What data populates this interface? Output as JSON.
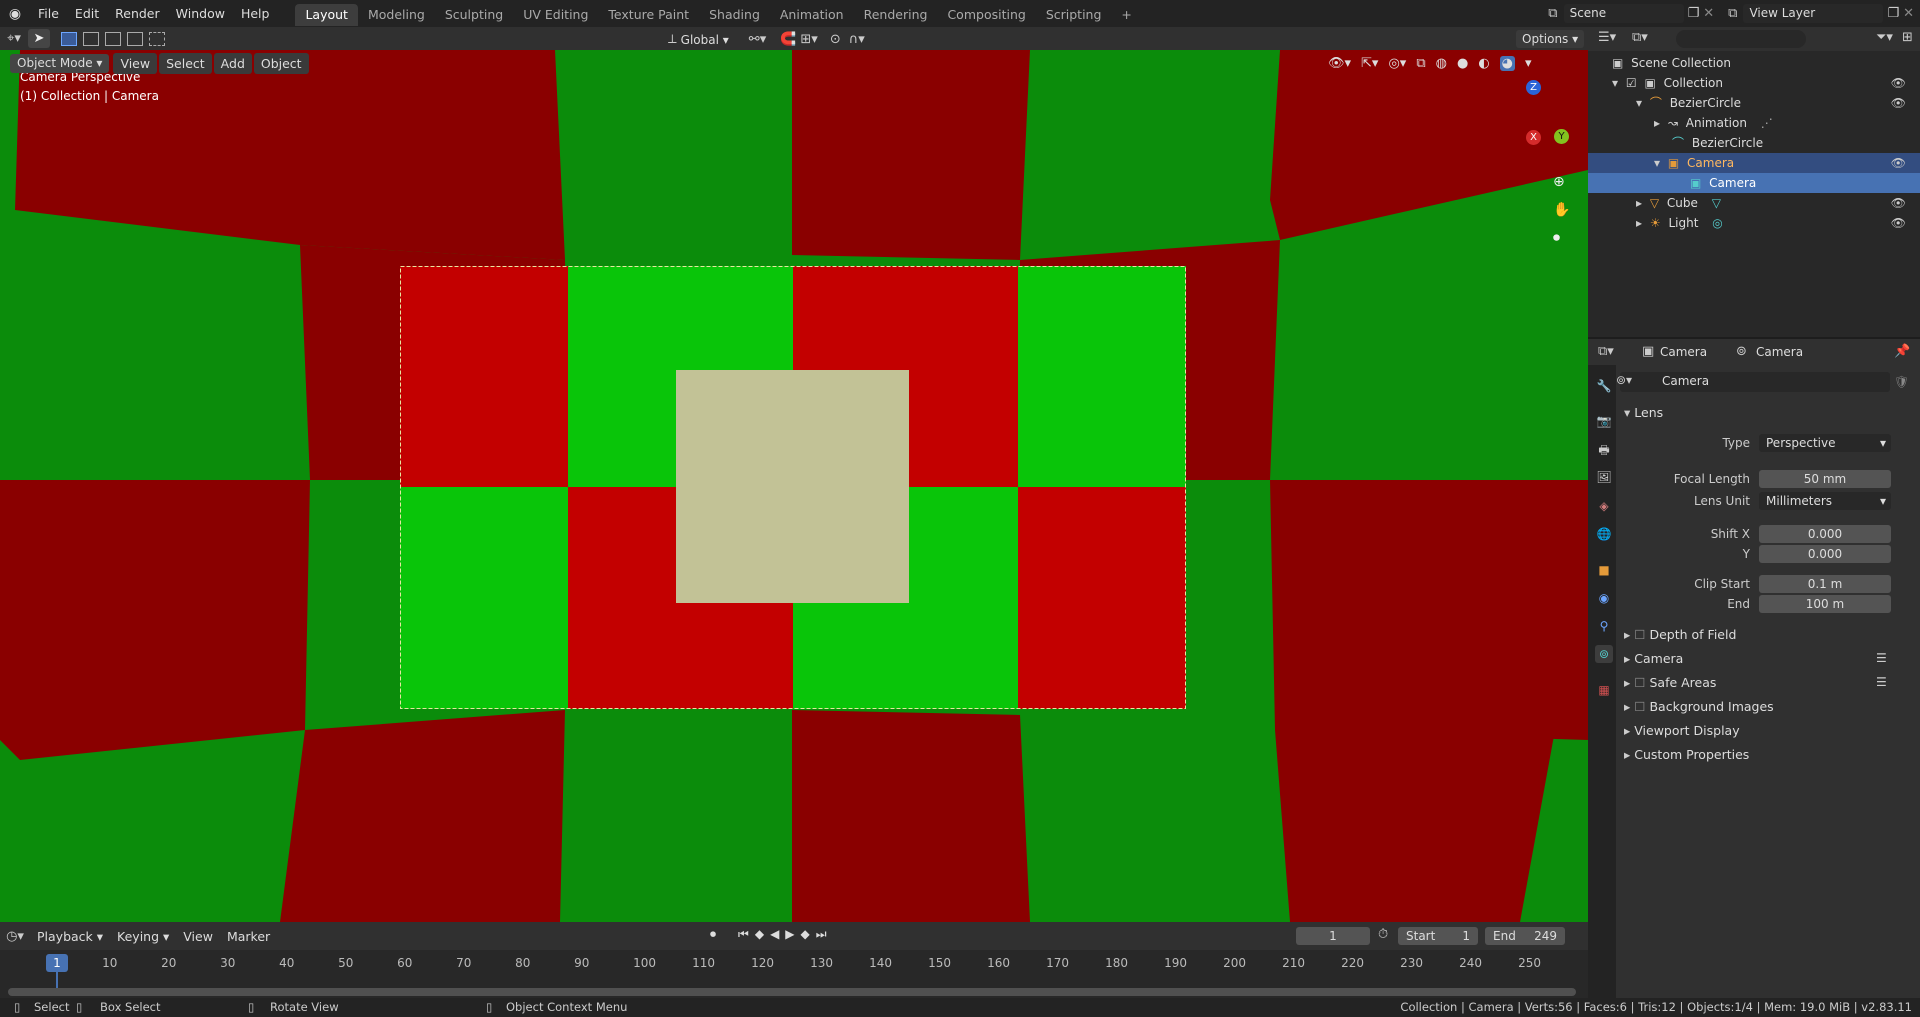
{
  "topbar": {
    "menus": [
      "File",
      "Edit",
      "Render",
      "Window",
      "Help"
    ],
    "workspaces": [
      "Layout",
      "Modeling",
      "Sculpting",
      "UV Editing",
      "Texture Paint",
      "Shading",
      "Animation",
      "Rendering",
      "Compositing",
      "Scripting"
    ],
    "active_workspace": "Layout",
    "add_tab": "+",
    "scene": "Scene",
    "view_layer": "View Layer"
  },
  "viewport_header": {
    "mode": "Object Mode",
    "menus": [
      "View",
      "Select",
      "Add",
      "Object"
    ],
    "orientation": "Global",
    "options": "Options"
  },
  "viewport": {
    "overlay_title": "Camera Perspective",
    "overlay_subtitle": "(1) Collection | Camera",
    "gizmo_axes": {
      "z": "Z",
      "x": "X",
      "y": "Y"
    },
    "colors": {
      "red": "#c30000",
      "green": "#09c509",
      "dark_red": "#8a0000",
      "dark_green": "#0b8c0b",
      "cube": "#c2c296"
    }
  },
  "outliner": {
    "rows": [
      {
        "label": "Scene Collection",
        "icon": "scene-collection-icon"
      },
      {
        "label": "Collection",
        "icon": "collection-icon"
      },
      {
        "label": "BezierCircle",
        "icon": "curve-icon"
      },
      {
        "label": "Animation",
        "icon": "animation-icon"
      },
      {
        "label": "BezierCircle",
        "icon": "curve-data-icon"
      },
      {
        "label": "Camera",
        "icon": "camera-icon"
      },
      {
        "label": "Camera",
        "icon": "camera-data-icon"
      },
      {
        "label": "Cube",
        "icon": "mesh-icon"
      },
      {
        "label": "Light",
        "icon": "light-icon"
      }
    ]
  },
  "properties": {
    "breadcrumb_object": "Camera",
    "breadcrumb_data": "Camera",
    "datablock": "Camera",
    "lens_panel": "Lens",
    "type_label": "Type",
    "type_value": "Perspective",
    "focal_length_label": "Focal Length",
    "focal_length_value": "50 mm",
    "lens_unit_label": "Lens Unit",
    "lens_unit_value": "Millimeters",
    "shift_x_label": "Shift X",
    "shift_x_value": "0.000",
    "shift_y_label": "Y",
    "shift_y_value": "0.000",
    "clip_start_label": "Clip Start",
    "clip_start_value": "0.1 m",
    "clip_end_label": "End",
    "clip_end_value": "100 m",
    "panels": [
      "Depth of Field",
      "Camera",
      "Safe Areas",
      "Background Images",
      "Viewport Display",
      "Custom Properties"
    ]
  },
  "timeline": {
    "menus": [
      "Playback",
      "Keying",
      "View",
      "Marker"
    ],
    "current_frame": "1",
    "start_label": "Start",
    "start_value": "1",
    "end_label": "End",
    "end_value": "249",
    "ticks": [
      "10",
      "20",
      "30",
      "40",
      "50",
      "60",
      "70",
      "80",
      "90",
      "100",
      "110",
      "120",
      "130",
      "140",
      "150",
      "160",
      "170",
      "180",
      "190",
      "200",
      "210",
      "220",
      "230",
      "240",
      "250"
    ],
    "playhead": "1"
  },
  "statusbar": {
    "select": "Select",
    "box_select": "Box Select",
    "rotate_view": "Rotate View",
    "context_menu": "Object Context Menu",
    "stats": "Collection | Camera | Verts:56 | Faces:6 | Tris:12 | Objects:1/4 | Mem: 19.0 MiB | v2.83.11"
  }
}
